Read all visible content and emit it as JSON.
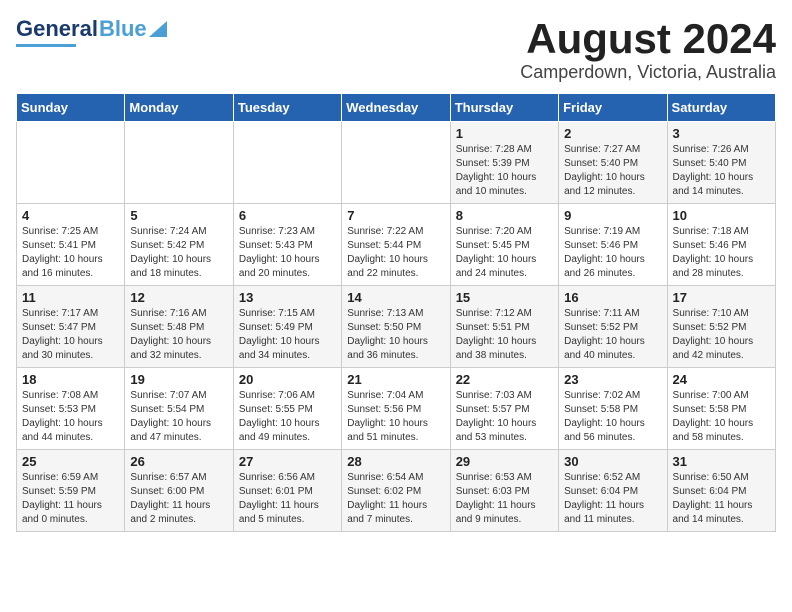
{
  "header": {
    "logo_general": "General",
    "logo_blue": "Blue",
    "title": "August 2024",
    "subtitle": "Camperdown, Victoria, Australia"
  },
  "days_of_week": [
    "Sunday",
    "Monday",
    "Tuesday",
    "Wednesday",
    "Thursday",
    "Friday",
    "Saturday"
  ],
  "weeks": [
    [
      {
        "day": "",
        "info": ""
      },
      {
        "day": "",
        "info": ""
      },
      {
        "day": "",
        "info": ""
      },
      {
        "day": "",
        "info": ""
      },
      {
        "day": "1",
        "info": "Sunrise: 7:28 AM\nSunset: 5:39 PM\nDaylight: 10 hours\nand 10 minutes."
      },
      {
        "day": "2",
        "info": "Sunrise: 7:27 AM\nSunset: 5:40 PM\nDaylight: 10 hours\nand 12 minutes."
      },
      {
        "day": "3",
        "info": "Sunrise: 7:26 AM\nSunset: 5:40 PM\nDaylight: 10 hours\nand 14 minutes."
      }
    ],
    [
      {
        "day": "4",
        "info": "Sunrise: 7:25 AM\nSunset: 5:41 PM\nDaylight: 10 hours\nand 16 minutes."
      },
      {
        "day": "5",
        "info": "Sunrise: 7:24 AM\nSunset: 5:42 PM\nDaylight: 10 hours\nand 18 minutes."
      },
      {
        "day": "6",
        "info": "Sunrise: 7:23 AM\nSunset: 5:43 PM\nDaylight: 10 hours\nand 20 minutes."
      },
      {
        "day": "7",
        "info": "Sunrise: 7:22 AM\nSunset: 5:44 PM\nDaylight: 10 hours\nand 22 minutes."
      },
      {
        "day": "8",
        "info": "Sunrise: 7:20 AM\nSunset: 5:45 PM\nDaylight: 10 hours\nand 24 minutes."
      },
      {
        "day": "9",
        "info": "Sunrise: 7:19 AM\nSunset: 5:46 PM\nDaylight: 10 hours\nand 26 minutes."
      },
      {
        "day": "10",
        "info": "Sunrise: 7:18 AM\nSunset: 5:46 PM\nDaylight: 10 hours\nand 28 minutes."
      }
    ],
    [
      {
        "day": "11",
        "info": "Sunrise: 7:17 AM\nSunset: 5:47 PM\nDaylight: 10 hours\nand 30 minutes."
      },
      {
        "day": "12",
        "info": "Sunrise: 7:16 AM\nSunset: 5:48 PM\nDaylight: 10 hours\nand 32 minutes."
      },
      {
        "day": "13",
        "info": "Sunrise: 7:15 AM\nSunset: 5:49 PM\nDaylight: 10 hours\nand 34 minutes."
      },
      {
        "day": "14",
        "info": "Sunrise: 7:13 AM\nSunset: 5:50 PM\nDaylight: 10 hours\nand 36 minutes."
      },
      {
        "day": "15",
        "info": "Sunrise: 7:12 AM\nSunset: 5:51 PM\nDaylight: 10 hours\nand 38 minutes."
      },
      {
        "day": "16",
        "info": "Sunrise: 7:11 AM\nSunset: 5:52 PM\nDaylight: 10 hours\nand 40 minutes."
      },
      {
        "day": "17",
        "info": "Sunrise: 7:10 AM\nSunset: 5:52 PM\nDaylight: 10 hours\nand 42 minutes."
      }
    ],
    [
      {
        "day": "18",
        "info": "Sunrise: 7:08 AM\nSunset: 5:53 PM\nDaylight: 10 hours\nand 44 minutes."
      },
      {
        "day": "19",
        "info": "Sunrise: 7:07 AM\nSunset: 5:54 PM\nDaylight: 10 hours\nand 47 minutes."
      },
      {
        "day": "20",
        "info": "Sunrise: 7:06 AM\nSunset: 5:55 PM\nDaylight: 10 hours\nand 49 minutes."
      },
      {
        "day": "21",
        "info": "Sunrise: 7:04 AM\nSunset: 5:56 PM\nDaylight: 10 hours\nand 51 minutes."
      },
      {
        "day": "22",
        "info": "Sunrise: 7:03 AM\nSunset: 5:57 PM\nDaylight: 10 hours\nand 53 minutes."
      },
      {
        "day": "23",
        "info": "Sunrise: 7:02 AM\nSunset: 5:58 PM\nDaylight: 10 hours\nand 56 minutes."
      },
      {
        "day": "24",
        "info": "Sunrise: 7:00 AM\nSunset: 5:58 PM\nDaylight: 10 hours\nand 58 minutes."
      }
    ],
    [
      {
        "day": "25",
        "info": "Sunrise: 6:59 AM\nSunset: 5:59 PM\nDaylight: 11 hours\nand 0 minutes."
      },
      {
        "day": "26",
        "info": "Sunrise: 6:57 AM\nSunset: 6:00 PM\nDaylight: 11 hours\nand 2 minutes."
      },
      {
        "day": "27",
        "info": "Sunrise: 6:56 AM\nSunset: 6:01 PM\nDaylight: 11 hours\nand 5 minutes."
      },
      {
        "day": "28",
        "info": "Sunrise: 6:54 AM\nSunset: 6:02 PM\nDaylight: 11 hours\nand 7 minutes."
      },
      {
        "day": "29",
        "info": "Sunrise: 6:53 AM\nSunset: 6:03 PM\nDaylight: 11 hours\nand 9 minutes."
      },
      {
        "day": "30",
        "info": "Sunrise: 6:52 AM\nSunset: 6:04 PM\nDaylight: 11 hours\nand 11 minutes."
      },
      {
        "day": "31",
        "info": "Sunrise: 6:50 AM\nSunset: 6:04 PM\nDaylight: 11 hours\nand 14 minutes."
      }
    ]
  ]
}
